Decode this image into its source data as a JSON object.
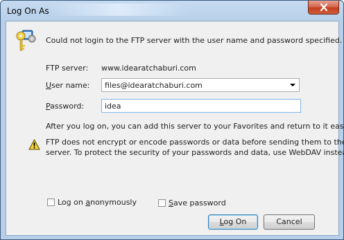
{
  "window": {
    "title": "Log On As"
  },
  "message": "Could not login to the FTP server with the user name and password specified.",
  "ftp_server": {
    "label": "FTP server:",
    "value": "www.idearatchaburi.com"
  },
  "user_name": {
    "label_pre": "",
    "label_u": "U",
    "label_rest": "ser name:",
    "value": "files@idearatchaburi.com"
  },
  "password": {
    "label_u": "P",
    "label_rest": "assword:",
    "value": "idea"
  },
  "favorites_note": "After you log on, you can add this server to your Favorites and return to it easily.",
  "warning": {
    "line1": "FTP does not encrypt or encode passwords or data before sending them to the",
    "line2": "server.  To protect the security of your passwords and data, use WebDAV instead."
  },
  "options": {
    "anon_pre": "Log on ",
    "anon_u": "a",
    "anon_rest": "nonymously",
    "anon_checked": false,
    "save_u": "S",
    "save_rest": "ave password",
    "save_checked": false
  },
  "buttons": {
    "logon_pre": "",
    "logon_u": "L",
    "logon_rest": "og On",
    "cancel": "Cancel"
  },
  "icons": {
    "keys": "keys-icon",
    "warning": "warning-icon",
    "close": "close-icon",
    "dropdown": "chevron-down-icon"
  }
}
